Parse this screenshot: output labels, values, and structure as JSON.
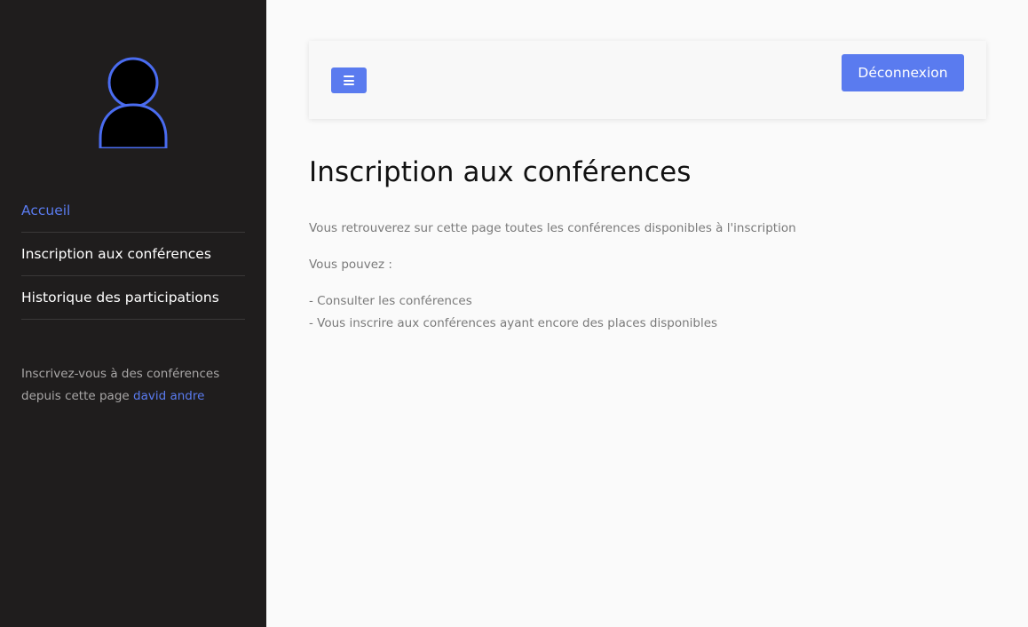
{
  "sidebar": {
    "nav": [
      {
        "label": "Accueil"
      },
      {
        "label": "Inscription aux conférences"
      },
      {
        "label": "Historique des participations"
      }
    ],
    "note_text": "Inscrivez-vous à des conférences depuis cette page ",
    "note_user": "david andre"
  },
  "topbar": {
    "menu_icon": "bars-icon",
    "logout_label": "Déconnexion"
  },
  "main": {
    "title": "Inscription aux conférences",
    "paragraphs": [
      "Vous retrouverez sur cette page toutes les conférences disponibles à l'inscription",
      "Vous pouvez :",
      "- Consulter les conférences",
      "- Vous inscrire aux conférences ayant encore des places disponibles"
    ]
  },
  "colors": {
    "accent": "#5a7bef",
    "sidebar_bg": "#1f1d1d",
    "page_bg": "#fafafa"
  }
}
